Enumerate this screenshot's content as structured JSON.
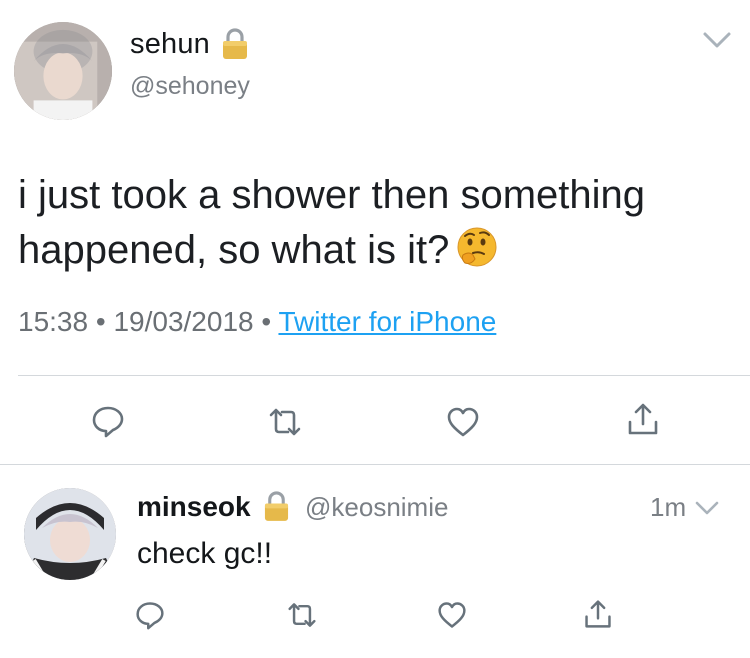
{
  "main_tweet": {
    "display_name": "sehun",
    "handle": "@sehoney",
    "text_line1": "i just took a shower then something",
    "text_line2": "happened, so what is it?",
    "emoji": "thinking-face",
    "time": "15:38",
    "date": "19/03/2018",
    "separator": "•",
    "source": "Twitter for iPhone",
    "protected": true
  },
  "reply": {
    "display_name": "minseok",
    "handle": "@keosnimie",
    "timestamp": "1m",
    "text": "check gc!!",
    "protected": true
  },
  "actions": [
    "reply-icon",
    "retweet-icon",
    "like-icon",
    "share-icon"
  ],
  "colors": {
    "link": "#1da1f2",
    "secondary_text": "#7a7f85",
    "icon": "#67727b",
    "divider": "#d4d8dc"
  }
}
